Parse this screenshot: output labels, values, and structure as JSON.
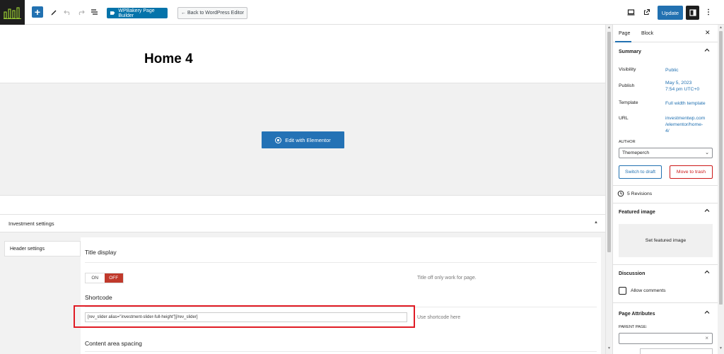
{
  "toolbar": {
    "wpbakery_label": "WPBakery Page Builder",
    "back_label": "← Back to WordPress Editor",
    "update_label": "Update",
    "icons": [
      "logo-icon",
      "add-block-icon",
      "pencil-tool-icon",
      "undo-icon",
      "redo-icon",
      "list-view-icon",
      "desktop-preview-icon",
      "external-link-icon",
      "settings-panel-icon",
      "more-options-icon"
    ]
  },
  "canvas": {
    "page_title": "Home 4",
    "elementor_button": "Edit with Elementor"
  },
  "meta_box": {
    "title": "Investment settings",
    "tab_label": "Header settings",
    "title_display": {
      "heading": "Title display",
      "on_label": "ON",
      "off_label": "OFF",
      "selected": "OFF",
      "hint": "Title off only work for page."
    },
    "shortcode": {
      "heading": "Shortcode",
      "value": "[rev_slider alias=\"investment-slider-full-height\"][/rev_slider]",
      "hint": "Use shortcode here"
    },
    "spacing": {
      "heading": "Content area spacing"
    }
  },
  "sidebar": {
    "tabs": [
      "Page",
      "Block"
    ],
    "active_tab": "Page",
    "summary": {
      "heading": "Summary",
      "visibility_label": "Visibility",
      "visibility_value": "Public",
      "publish_label": "Publish",
      "publish_value_1": "May 5, 2023",
      "publish_value_2": "7:54 pm UTC+0",
      "template_label": "Template",
      "template_value": "Full width template",
      "url_label": "URL",
      "url_value_1": "investmentwp.com",
      "url_value_2": "/elementor/home-",
      "url_value_3": "4/",
      "author_label": "AUTHOR",
      "author_value": "Themeperch",
      "switch_draft": "Switch to draft",
      "move_trash": "Move to trash"
    },
    "revisions": "5 Revisions",
    "featured_image": {
      "heading": "Featured image",
      "set_label": "Set featured image"
    },
    "discussion": {
      "heading": "Discussion",
      "allow_comments": "Allow comments",
      "checked": false
    },
    "page_attributes": {
      "heading": "Page Attributes",
      "parent_label": "PARENT PAGE:",
      "parent_value": ""
    }
  },
  "colors": {
    "accent": "#2271b1",
    "elementor": "#2472b5",
    "wpbakery": "#0473aa",
    "off_toggle": "#c0392b",
    "highlight": "#e01b24",
    "danger": "#cc1818"
  }
}
